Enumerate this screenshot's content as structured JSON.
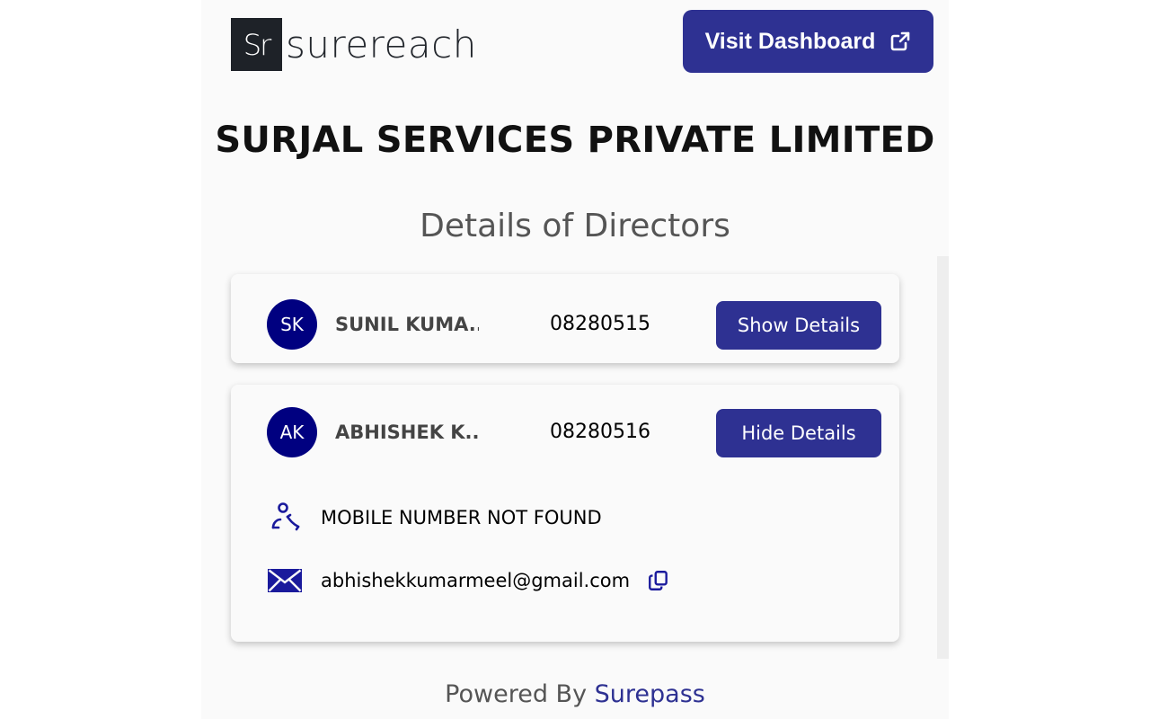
{
  "header": {
    "logo_mark": "Sr",
    "logo_text": "surereach",
    "dashboard_button": "Visit Dashboard"
  },
  "company_name": "SURJAL SERVICES PRIVATE LIMITED",
  "section_title": "Details of Directors",
  "directors": [
    {
      "initials": "SK",
      "name": "SUNIL KUMA...",
      "din": "08280515",
      "button": "Show Details"
    },
    {
      "initials": "AK",
      "name": "ABHISHEK K...",
      "din": "08280516",
      "button": "Hide Details",
      "mobile": "MOBILE NUMBER NOT FOUND",
      "email": "abhishekkumarmeel@gmail.com"
    }
  ],
  "footer": {
    "prefix": "Powered By",
    "brand": "Surepass"
  },
  "colors": {
    "primary": "#2e3192",
    "avatar": "#000080",
    "icon": "#1a1a9c"
  }
}
